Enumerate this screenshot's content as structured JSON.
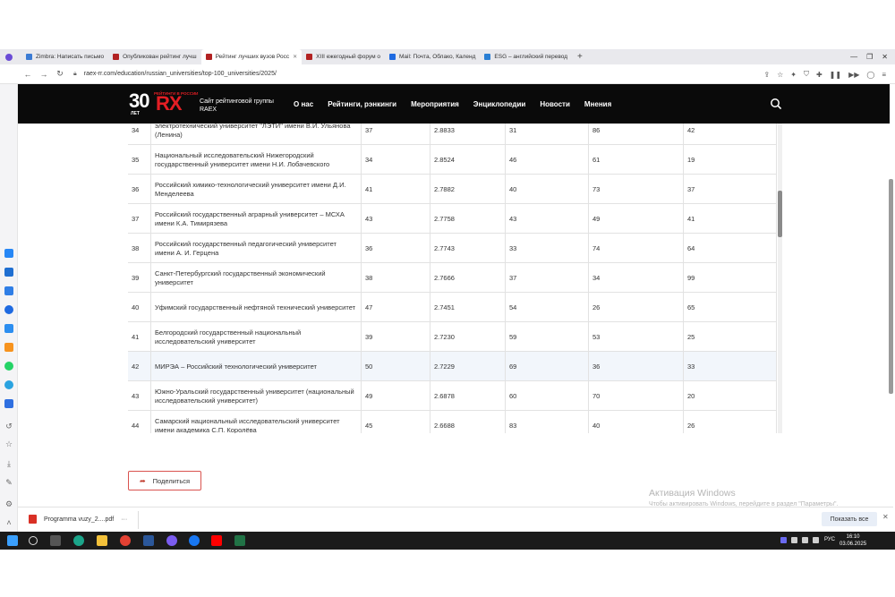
{
  "browser": {
    "tabs": [
      {
        "label": "Zimbra: Написать письмо",
        "color": "#3b7bd4"
      },
      {
        "label": "Опубликован рейтинг лучш",
        "color": "#b22222"
      },
      {
        "label": "Рейтинг лучших вузов Росс",
        "color": "#b22222",
        "active": true
      },
      {
        "label": "XIII ежегодный форум о",
        "color": "#b22222"
      },
      {
        "label": "Mail: Почта, Облако, Календ",
        "color": "#1e6ae1"
      },
      {
        "label": "ESG – английский перевод",
        "color": "#2a7fd4"
      }
    ],
    "new_tab": "+",
    "url": "raex-rr.com/education/russian_universities/top-100_universities/2025/"
  },
  "site": {
    "logo_number": "30",
    "logo_years": "ЛЕТ",
    "logo_brand": "RX",
    "logo_tagline": "РЕЙТИНГИ В РОССИИ",
    "subtitle": "Сайт рейтинговой группы RAEX",
    "nav": [
      "О нас",
      "Рейтинги, рэнкинги",
      "Мероприятия",
      "Энциклопедии",
      "Новости",
      "Мнения"
    ]
  },
  "table": {
    "rows": [
      {
        "rank": "34",
        "name": "электротехнический университет \"ЛЭТИ\" имени В.И. Ульянова (Ленина)",
        "a": "37",
        "b": "2.8833",
        "c": "31",
        "d": "86",
        "e": "42"
      },
      {
        "rank": "35",
        "name": "Национальный исследовательский Нижегородский государственный университет имени Н.И. Лобачевского",
        "a": "34",
        "b": "2.8524",
        "c": "46",
        "d": "61",
        "e": "19"
      },
      {
        "rank": "36",
        "name": "Российский химико-технологический университет имени Д.И. Менделеева",
        "a": "41",
        "b": "2.7882",
        "c": "40",
        "d": "73",
        "e": "37"
      },
      {
        "rank": "37",
        "name": "Российский государственный аграрный университет – МСХА имени К.А. Тимирязева",
        "a": "43",
        "b": "2.7758",
        "c": "43",
        "d": "49",
        "e": "41"
      },
      {
        "rank": "38",
        "name": "Российский государственный педагогический университет имени А. И. Герцена",
        "a": "36",
        "b": "2.7743",
        "c": "33",
        "d": "74",
        "e": "64"
      },
      {
        "rank": "39",
        "name": "Санкт-Петербургский государственный экономический университет",
        "a": "38",
        "b": "2.7666",
        "c": "37",
        "d": "34",
        "e": "99"
      },
      {
        "rank": "40",
        "name": "Уфимский государственный нефтяной технический университет",
        "a": "47",
        "b": "2.7451",
        "c": "54",
        "d": "26",
        "e": "65"
      },
      {
        "rank": "41",
        "name": "Белгородский государственный национальный исследовательский университет",
        "a": "39",
        "b": "2.7230",
        "c": "59",
        "d": "53",
        "e": "25"
      },
      {
        "rank": "42",
        "name": "МИРЭА – Российский технологический университет",
        "a": "50",
        "b": "2.7229",
        "c": "69",
        "d": "36",
        "e": "33",
        "highlight": true
      },
      {
        "rank": "43",
        "name": "Южно-Уральский государственный университет (национальный исследовательский университет)",
        "a": "49",
        "b": "2.6878",
        "c": "60",
        "d": "70",
        "e": "20"
      },
      {
        "rank": "44",
        "name": "Самарский национальный исследовательский университет имени академика С.П. Королёва",
        "a": "45",
        "b": "2.6688",
        "c": "83",
        "d": "40",
        "e": "26"
      }
    ]
  },
  "share_label": "Поделиться",
  "activation": {
    "title": "Активация Windows",
    "text": "Чтобы активировать Windows, перейдите в раздел \"Параметры\"."
  },
  "downloads": {
    "file": "Programma vuzy_2....pdf",
    "more": "···",
    "show_all": "Показать все",
    "close": "✕"
  },
  "taskbar": {
    "lang": "РУС",
    "time": "16:10",
    "date": "03.06.2025"
  }
}
